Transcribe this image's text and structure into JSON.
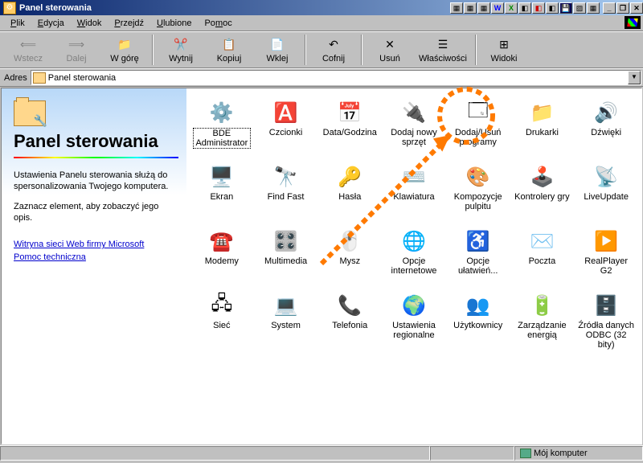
{
  "window": {
    "title": "Panel sterowania"
  },
  "menu": {
    "items": [
      {
        "label": "Plik",
        "u": 0
      },
      {
        "label": "Edycja",
        "u": 0
      },
      {
        "label": "Widok",
        "u": 0
      },
      {
        "label": "Przejdź",
        "u": 0
      },
      {
        "label": "Ulubione",
        "u": 0
      },
      {
        "label": "Pomoc",
        "u": 2
      }
    ]
  },
  "toolbar": {
    "back": "Wstecz",
    "forward": "Dalej",
    "up": "W górę",
    "cut": "Wytnij",
    "copy": "Kopiuj",
    "paste": "Wklej",
    "undo": "Cofnij",
    "delete": "Usuń",
    "properties": "Właściwości",
    "views": "Widoki"
  },
  "addressbar": {
    "label": "Adres",
    "value": "Panel sterowania"
  },
  "leftpane": {
    "title": "Panel sterowania",
    "desc1": "Ustawienia Panelu sterowania służą do spersonalizowania Twojego komputera.",
    "desc2": "Zaznacz element, aby zobaczyć jego opis.",
    "link1": "Witryna sieci Web firmy Microsoft",
    "link2": "Pomoc techniczna"
  },
  "icons": [
    {
      "name": "bde-administrator",
      "label": "BDE Administrator",
      "glyph": "⚙️",
      "selected": true
    },
    {
      "name": "czcionki",
      "label": "Czcionki",
      "glyph": "🅰️"
    },
    {
      "name": "data-godzina",
      "label": "Data/Godzina",
      "glyph": "📅"
    },
    {
      "name": "dodaj-sprzet",
      "label": "Dodaj nowy sprzęt",
      "glyph": "🔌"
    },
    {
      "name": "dodaj-usun-programy",
      "label": "Dodaj/Usuń programy",
      "glyph": "🗔"
    },
    {
      "name": "drukarki",
      "label": "Drukarki",
      "glyph": "📁"
    },
    {
      "name": "dzwieki",
      "label": "Dźwięki",
      "glyph": "🔊"
    },
    {
      "name": "ekran",
      "label": "Ekran",
      "glyph": "🖥️"
    },
    {
      "name": "find-fast",
      "label": "Find Fast",
      "glyph": "🔭"
    },
    {
      "name": "hasla",
      "label": "Hasła",
      "glyph": "🔑"
    },
    {
      "name": "klawiatura",
      "label": "Klawiatura",
      "glyph": "⌨️"
    },
    {
      "name": "kompozycje-pulpitu",
      "label": "Kompozycje pulpitu",
      "glyph": "🎨"
    },
    {
      "name": "kontrolery-gry",
      "label": "Kontrolery gry",
      "glyph": "🕹️"
    },
    {
      "name": "liveupdate",
      "label": "LiveUpdate",
      "glyph": "📡"
    },
    {
      "name": "modemy",
      "label": "Modemy",
      "glyph": "☎️"
    },
    {
      "name": "multimedia",
      "label": "Multimedia",
      "glyph": "🎛️"
    },
    {
      "name": "mysz",
      "label": "Mysz",
      "glyph": "🖱️"
    },
    {
      "name": "opcje-internetowe",
      "label": "Opcje internetowe",
      "glyph": "🌐"
    },
    {
      "name": "opcje-ulatwien",
      "label": "Opcje ułatwień...",
      "glyph": "♿"
    },
    {
      "name": "poczta",
      "label": "Poczta",
      "glyph": "✉️"
    },
    {
      "name": "realplayer",
      "label": "RealPlayer G2",
      "glyph": "▶️"
    },
    {
      "name": "siec",
      "label": "Sieć",
      "glyph": "🖧"
    },
    {
      "name": "system",
      "label": "System",
      "glyph": "💻"
    },
    {
      "name": "telefonia",
      "label": "Telefonia",
      "glyph": "📞"
    },
    {
      "name": "ustawienia-regionalne",
      "label": "Ustawienia regionalne",
      "glyph": "🌍"
    },
    {
      "name": "uzytkownicy",
      "label": "Użytkownicy",
      "glyph": "👥"
    },
    {
      "name": "zarzadzanie-energia",
      "label": "Zarządzanie energią",
      "glyph": "🔋"
    },
    {
      "name": "zrodla-odbc",
      "label": "Źródła danych ODBC (32 bity)",
      "glyph": "🗄️"
    }
  ],
  "statusbar": {
    "right": "Mój komputer"
  }
}
